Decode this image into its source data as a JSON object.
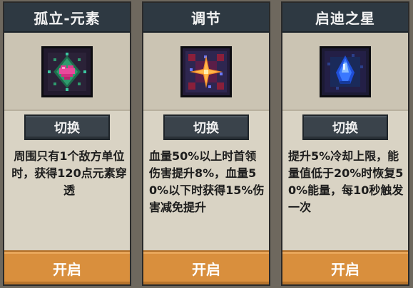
{
  "cards": [
    {
      "title": "孤立-元素",
      "icon": "gem-pink-green-icon",
      "switch_label": "切换",
      "description": "周围只有1个敌方单位时，获得120点元素穿透",
      "enable_label": "开启"
    },
    {
      "title": "调节",
      "icon": "star-orange-icon",
      "switch_label": "切换",
      "description": "血量50%以上时首领伤害提升8%，血量50%以下时获得15%伤害减免提升",
      "enable_label": "开启"
    },
    {
      "title": "启迪之星",
      "icon": "crystal-blue-icon",
      "switch_label": "切换",
      "description": "提升5%冷却上限，能量值低于20%时恢复50%能量，每10秒触发一次",
      "enable_label": "开启"
    }
  ],
  "colors": {
    "header": "#2e3942",
    "card_bg": "#d9d3c4",
    "switch_button": "#3a434b",
    "enable_button": "#d98f3d"
  }
}
